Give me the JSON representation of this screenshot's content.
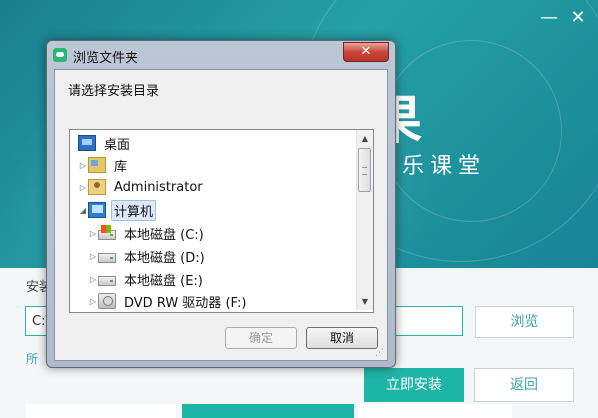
{
  "installer": {
    "window_controls": {
      "minimize": "—",
      "close": "✕"
    },
    "brand_char": "果",
    "brand_sub": "乐课堂",
    "install_label": "安装",
    "path_value": "C:\\",
    "browse_label": "浏览",
    "agree_text": "所",
    "install_label_button": "立即安装",
    "back_label": "返回",
    "accent": "#1fb5a6"
  },
  "dialog": {
    "title": "浏览文件夹",
    "close_glyph": "✕",
    "prompt": "请选择安装目录",
    "tree": [
      {
        "label": "桌面",
        "icon": "desktop-icon",
        "arrow": ""
      },
      {
        "label": "库",
        "icon": "library-icon",
        "arrow": "▷"
      },
      {
        "label": "Administrator",
        "icon": "user-folder-icon",
        "arrow": "▷"
      },
      {
        "label": "计算机",
        "icon": "computer-icon",
        "arrow": "◢"
      },
      {
        "label": "本地磁盘 (C:)",
        "icon": "system-drive-icon",
        "arrow": "▷"
      },
      {
        "label": "本地磁盘 (D:)",
        "icon": "drive-icon",
        "arrow": "▷"
      },
      {
        "label": "本地磁盘 (E:)",
        "icon": "drive-icon",
        "arrow": "▷"
      },
      {
        "label": "DVD RW 驱动器 (F:)",
        "icon": "dvd-drive-icon",
        "arrow": "▷"
      }
    ],
    "ok_label": "确定",
    "cancel_label": "取消",
    "scroll_up": "▲",
    "scroll_down": "▼"
  }
}
